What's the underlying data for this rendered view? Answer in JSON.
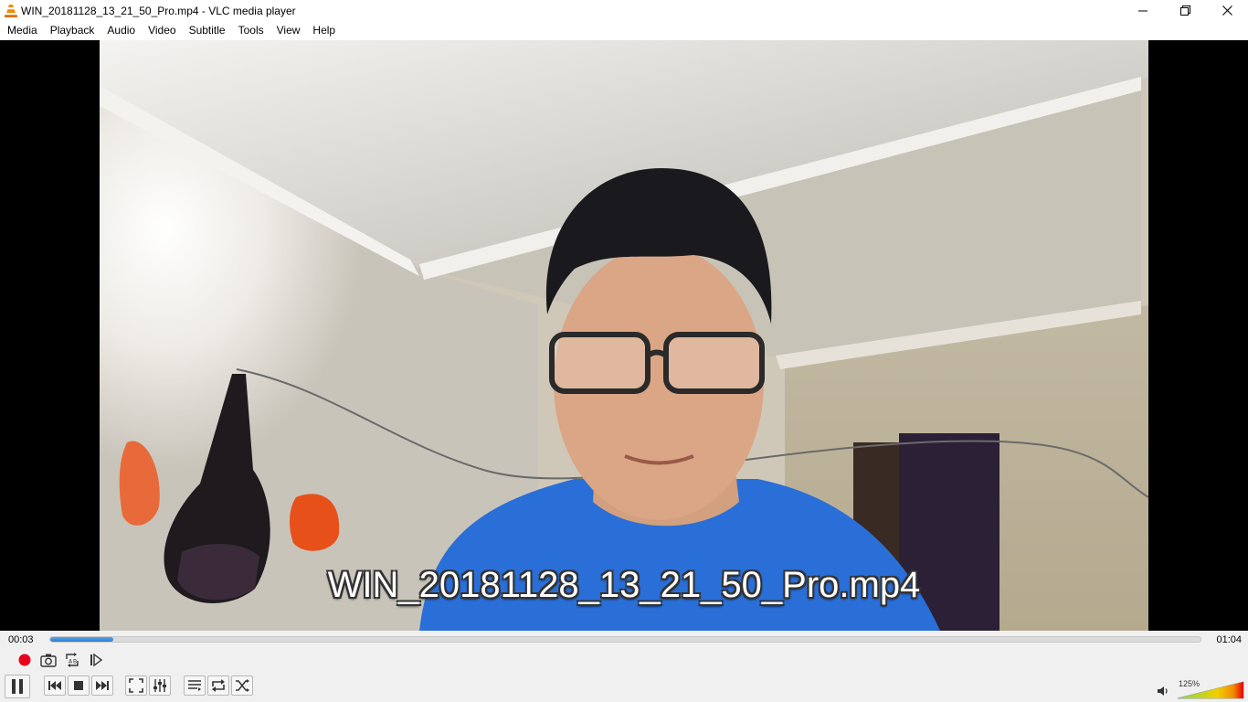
{
  "window": {
    "title": "WIN_20181128_13_21_50_Pro.mp4 - VLC media player",
    "minimize_icon": "minimize-icon",
    "maximize_icon": "restore-icon",
    "close_icon": "close-icon"
  },
  "menu": {
    "items": [
      "Media",
      "Playback",
      "Audio",
      "Video",
      "Subtitle",
      "Tools",
      "View",
      "Help"
    ]
  },
  "video": {
    "overlay_title": "WIN_20181128_13_21_50_Pro.mp4"
  },
  "playback": {
    "elapsed": "00:03",
    "total": "01:04",
    "progress_fraction": 0.055
  },
  "controls": {
    "row1_icons": [
      "record-icon",
      "snapshot-icon",
      "loop-ab-icon",
      "frame-step-icon"
    ],
    "row2_icons": [
      "pause-icon",
      "previous-icon",
      "stop-icon",
      "next-icon",
      "fullscreen-icon",
      "extended-settings-icon",
      "playlist-icon",
      "loop-icon",
      "shuffle-icon"
    ]
  },
  "volume": {
    "label": "125%",
    "level_percent": 125,
    "icon": "speaker-icon"
  },
  "colors": {
    "accent": "#2b7ccd",
    "record": "#e8001c",
    "video_bg": "#000000"
  }
}
